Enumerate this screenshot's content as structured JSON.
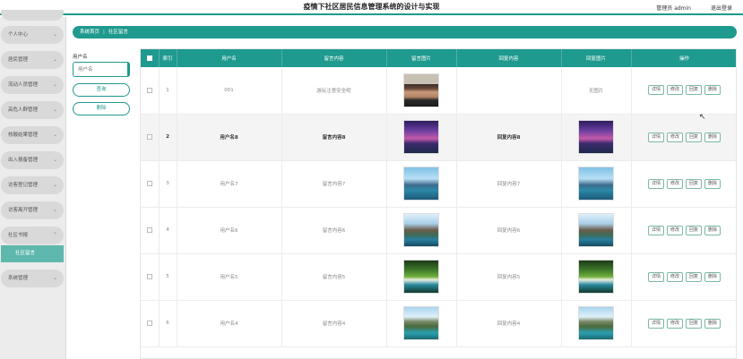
{
  "app": {
    "title": "疫情下社区居民信息管理系统的设计与实现",
    "user_label": "管理员 admin",
    "logout_label": "退出登录"
  },
  "sidebar": {
    "items": [
      {
        "label": "个人中心"
      },
      {
        "label": "居民管理"
      },
      {
        "label": "流动人员管理"
      },
      {
        "label": "高危人群管理"
      },
      {
        "label": "核酸结果管理"
      },
      {
        "label": "出入报备管理"
      },
      {
        "label": "访客登记管理"
      },
      {
        "label": "访客离开管理"
      },
      {
        "label": "社区书报"
      },
      {
        "label": "系统管理"
      }
    ],
    "active_sub": "社区留言"
  },
  "breadcrumb": {
    "home": "系统首页",
    "current": "社区留言"
  },
  "search": {
    "label": "用户名",
    "placeholder": "用户名",
    "query_button": "查询",
    "delete_button": "删除"
  },
  "table": {
    "headers": [
      "索引",
      "用户名",
      "留言内容",
      "留言图片",
      "回复内容",
      "回复图片",
      "操作"
    ],
    "actions": [
      "详情",
      "修改",
      "回复",
      "删除"
    ],
    "rows": [
      {
        "index": "1",
        "username": "001",
        "message": "游玩注意安全呢",
        "msg_img": "img-man",
        "reply": "",
        "reply_img": "",
        "reply_img_text": "无图片"
      },
      {
        "index": "2",
        "username": "用户名8",
        "message": "留言内容8",
        "msg_img": "img-purple",
        "reply": "回复内容8",
        "reply_img": "img-purple"
      },
      {
        "index": "3",
        "username": "用户名7",
        "message": "留言内容7",
        "msg_img": "img-lake",
        "reply": "回复内容7",
        "reply_img": "img-lake"
      },
      {
        "index": "4",
        "username": "用户名6",
        "message": "留言内容6",
        "msg_img": "img-mountain",
        "reply": "回复内容6",
        "reply_img": "img-mountain"
      },
      {
        "index": "5",
        "username": "用户名5",
        "message": "留言内容5",
        "msg_img": "img-waterfall",
        "reply": "回复内容5",
        "reply_img": "img-waterfall"
      },
      {
        "index": "6",
        "username": "用户名4",
        "message": "留言内容4",
        "msg_img": "img-cliff",
        "reply": "回复内容4",
        "reply_img": "img-cliff"
      }
    ]
  }
}
